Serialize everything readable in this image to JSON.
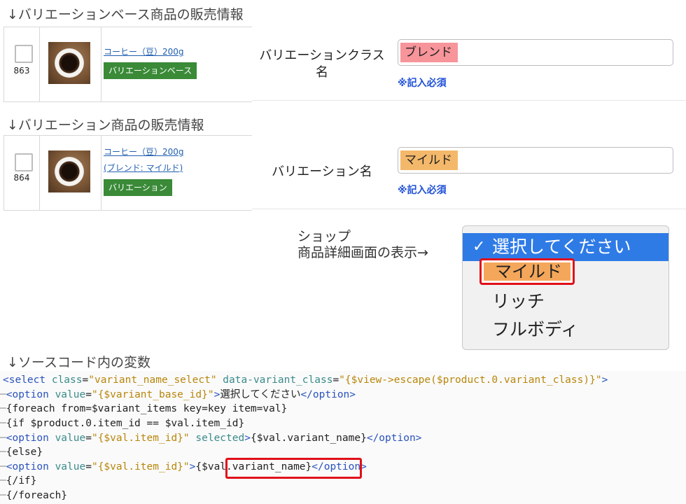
{
  "section_base": {
    "heading": "↓バリエーションベース商品の販売情報",
    "product_id": "863",
    "product_name": "コーヒー（豆）200g",
    "tag": "バリエーションベース",
    "field_label": "バリエーションクラス\n名",
    "field_value": "ブレンド",
    "field_value_bg": "#f7959a",
    "required_note": "※記入必須"
  },
  "section_variant": {
    "heading": "↓バリエーション商品の販売情報",
    "product_id": "864",
    "product_name_line1": "コーヒー（豆）200g",
    "product_name_line2": "(ブレンド: マイルド)",
    "tag": "バリエーション",
    "field_label": "バリエーション名",
    "field_value": "マイルド",
    "field_value_bg": "#f4b86a",
    "required_note": "※記入必須"
  },
  "shop_display": {
    "label_line1": "ショップ",
    "label_line2": "商品詳細画面の表示→",
    "dropdown": {
      "selected_label": "選択してください",
      "options": [
        "マイルド",
        "リッチ",
        "フルボディ"
      ],
      "highlight_color": "#f4a75a"
    }
  },
  "source_code": {
    "heading": "↓ソースコード内の変数",
    "lines": [
      "<select class=\"variant_name_select\" data-variant_class=\"{$view->escape($product.0.variant_class)}\">",
      "<option value=\"{$variant_base_id}\">選択してください</option>",
      "{foreach from=$variant_items key=key item=val}",
      "{if $product.0.item_id == $val.item_id}",
      "<option value=\"{$val.item_id}\" selected>{$val.variant_name}</option>",
      "{else}",
      "<option value=\"{$val.item_id}\">{$val.variant_name}</option>",
      "{/if}",
      "{/foreach}"
    ]
  }
}
